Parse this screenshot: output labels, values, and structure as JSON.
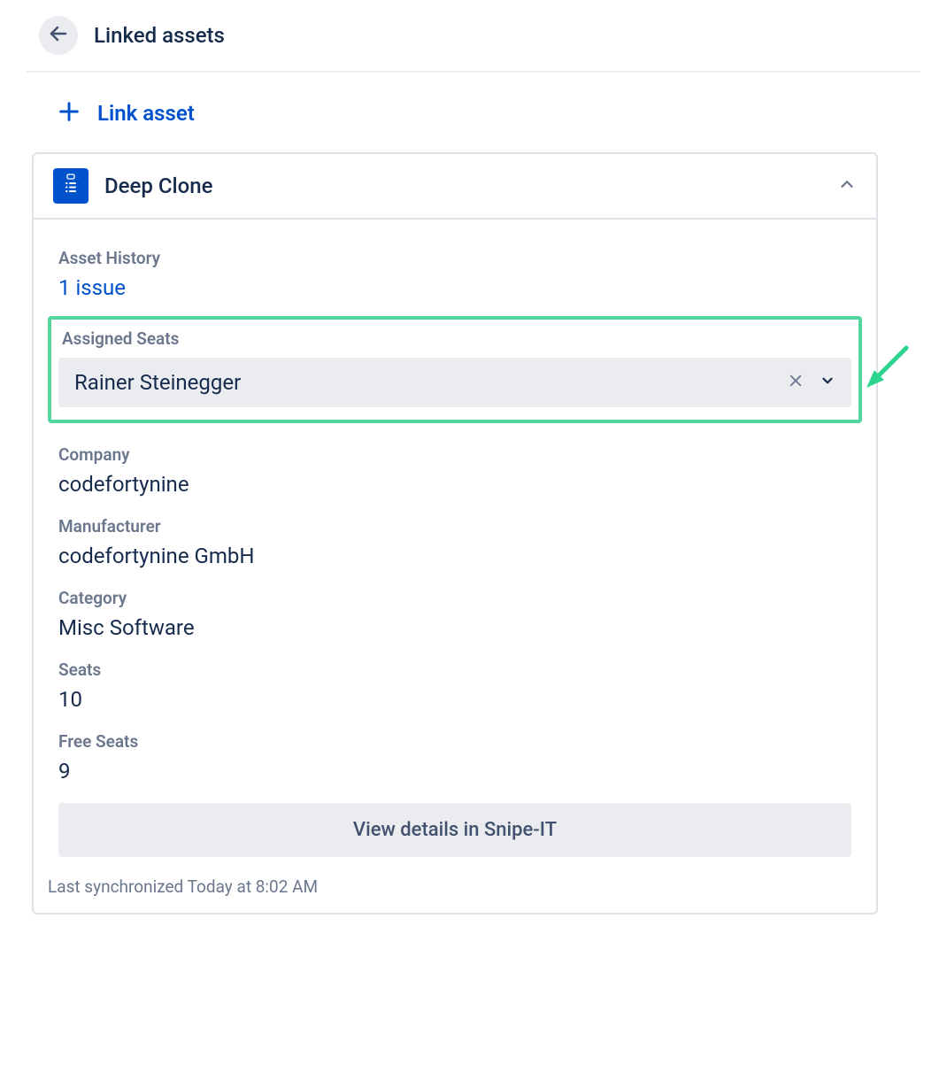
{
  "header": {
    "title": "Linked assets"
  },
  "link_asset": {
    "label": "Link asset"
  },
  "card": {
    "title": "Deep Clone",
    "asset_history": {
      "label": "Asset History",
      "value": "1 issue"
    },
    "assigned_seats": {
      "label": "Assigned Seats",
      "value": "Rainer Steinegger"
    },
    "company": {
      "label": "Company",
      "value": "codefortynine"
    },
    "manufacturer": {
      "label": "Manufacturer",
      "value": "codefortynine GmbH"
    },
    "category": {
      "label": "Category",
      "value": "Misc Software"
    },
    "seats": {
      "label": "Seats",
      "value": "10"
    },
    "free_seats": {
      "label": "Free Seats",
      "value": "9"
    },
    "view_button": "View details in Snipe-IT",
    "sync_text": "Last synchronized Today at 8:02 AM"
  }
}
